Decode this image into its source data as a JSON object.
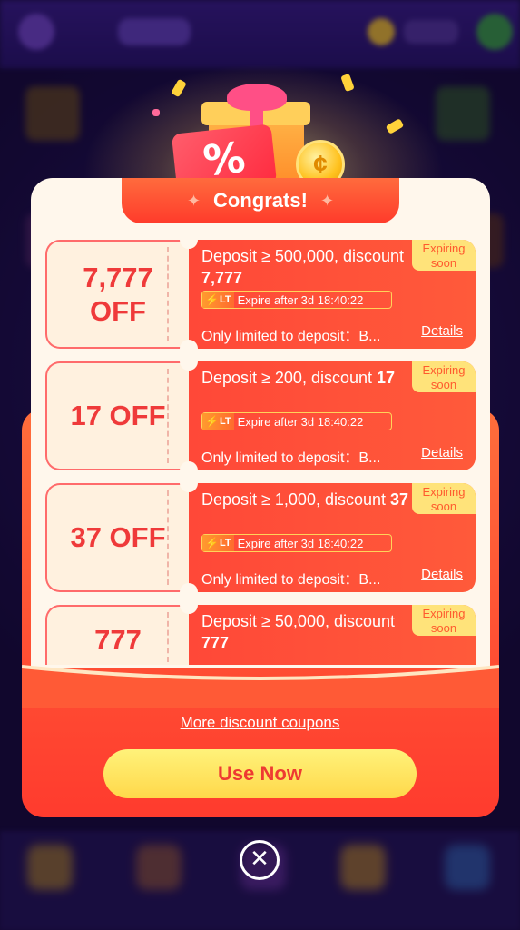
{
  "modal": {
    "title": "Congrats!",
    "coupons": [
      {
        "amount_line1": "7,777",
        "amount_line2": "OFF",
        "desc_prefix": "Deposit ≥ 500,000, discount ",
        "desc_amount": "7,777",
        "badge": "Expiring soon",
        "timer_tag": "LT",
        "timer_text": "Expire after 3d 18:40:22",
        "limit_text": "Only limited to deposit：B...",
        "details_label": "Details"
      },
      {
        "amount_line1": "17 OFF",
        "amount_line2": "",
        "desc_prefix": "Deposit ≥ 200, discount ",
        "desc_amount": "17",
        "badge": "Expiring soon",
        "timer_tag": "LT",
        "timer_text": "Expire after 3d 18:40:22",
        "limit_text": "Only limited to deposit：B...",
        "details_label": "Details"
      },
      {
        "amount_line1": "37 OFF",
        "amount_line2": "",
        "desc_prefix": "Deposit ≥ 1,000, discount ",
        "desc_amount": "37",
        "badge": "Expiring soon",
        "timer_tag": "LT",
        "timer_text": "Expire after 3d 18:40:22",
        "limit_text": "Only limited to deposit：B...",
        "details_label": "Details"
      },
      {
        "amount_line1": "777",
        "amount_line2": "",
        "desc_prefix": "Deposit ≥ 50,000, discount ",
        "desc_amount": "777",
        "badge": "Expiring soon",
        "timer_tag": "",
        "timer_text": "",
        "limit_text": "",
        "details_label": ""
      }
    ],
    "more_link": "More discount coupons",
    "use_button": "Use Now"
  },
  "icons": {
    "close": "close-icon",
    "percent": "%",
    "bolt": "⚡"
  },
  "colors": {
    "accent_red": "#ff4838",
    "button_yellow": "#ffe35a",
    "card_bg": "#fff7ec",
    "amount_red": "#ef3a3a"
  }
}
